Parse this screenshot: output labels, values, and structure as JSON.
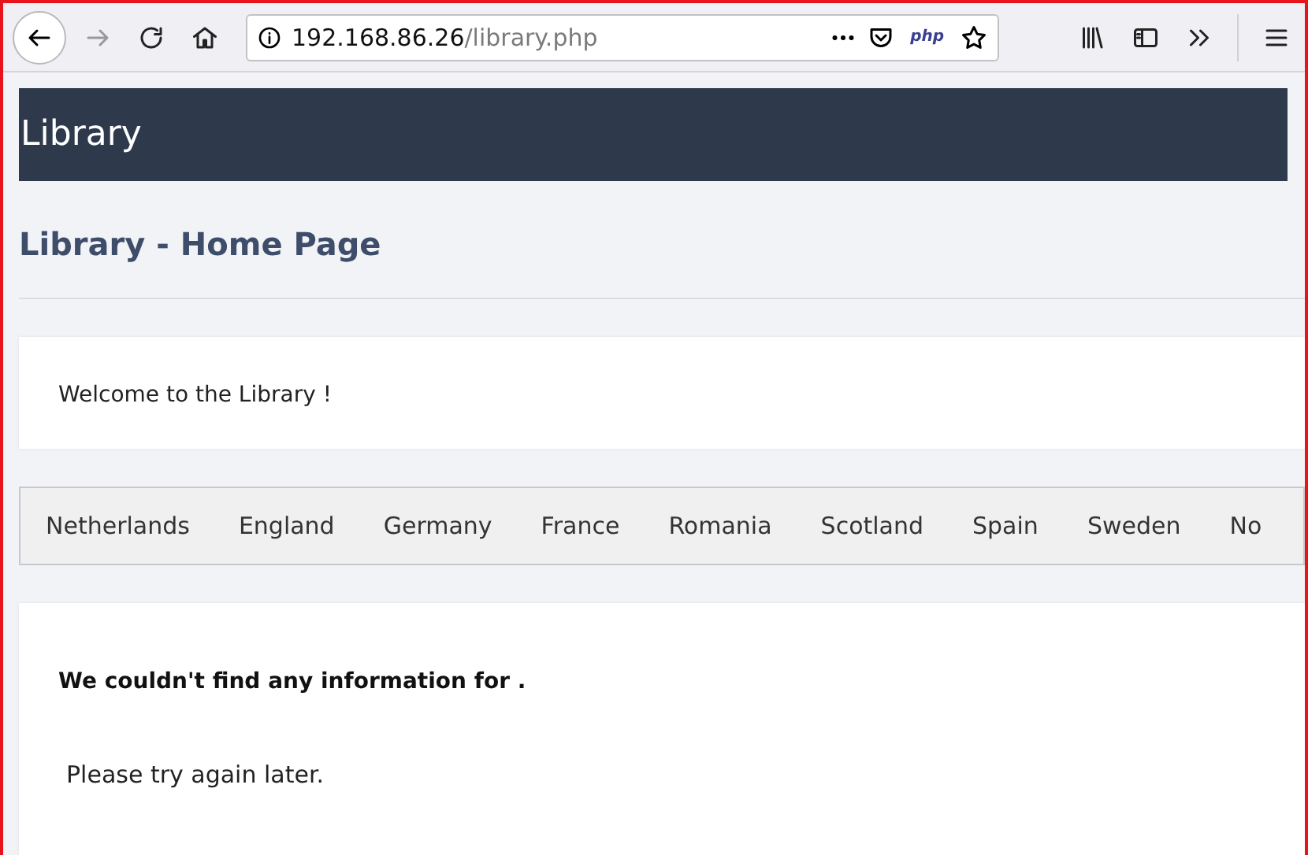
{
  "browser": {
    "url_host": "192.168.86.26",
    "url_path": "/library.php",
    "php_badge": "php"
  },
  "header": {
    "title": "Library"
  },
  "page_title": "Library - Home Page",
  "welcome": "Welcome to the Library !",
  "nav": [
    {
      "label": "Netherlands"
    },
    {
      "label": "England"
    },
    {
      "label": "Germany"
    },
    {
      "label": "France"
    },
    {
      "label": "Romania"
    },
    {
      "label": "Scotland"
    },
    {
      "label": "Spain"
    },
    {
      "label": "Sweden"
    },
    {
      "label": "No"
    }
  ],
  "message": {
    "heading": "We couldn't find any information for .",
    "body": "Please try again later."
  }
}
